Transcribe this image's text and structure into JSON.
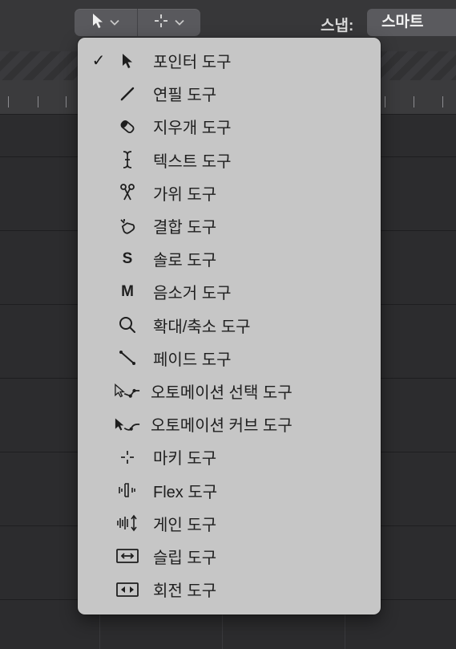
{
  "toolbar": {
    "left_tool_icon": "pointer-icon",
    "right_tool_icon": "marquee-crosshair-icon",
    "snap_label": "스냅:",
    "snap_value": "스마트"
  },
  "menu": {
    "items": [
      {
        "label": "포인터 도구",
        "icon": "pointer-icon",
        "checked": true
      },
      {
        "label": "연필 도구",
        "icon": "pencil-icon",
        "checked": false
      },
      {
        "label": "지우개 도구",
        "icon": "eraser-icon",
        "checked": false
      },
      {
        "label": "텍스트 도구",
        "icon": "text-cursor-icon",
        "checked": false
      },
      {
        "label": "가위 도구",
        "icon": "scissors-icon",
        "checked": false
      },
      {
        "label": "결합 도구",
        "icon": "glue-icon",
        "checked": false
      },
      {
        "label": "솔로 도구",
        "icon": "solo-letter-icon",
        "icon_text": "S",
        "checked": false
      },
      {
        "label": "음소거 도구",
        "icon": "mute-letter-icon",
        "icon_text": "M",
        "checked": false
      },
      {
        "label": "확대/축소 도구",
        "icon": "magnifier-icon",
        "checked": false
      },
      {
        "label": "페이드 도구",
        "icon": "fade-line-icon",
        "checked": false
      },
      {
        "label": "오토메이션 선택 도구",
        "icon": "automation-select-icon",
        "checked": false
      },
      {
        "label": "오토메이션 커브 도구",
        "icon": "automation-curve-icon",
        "checked": false
      },
      {
        "label": "마키 도구",
        "icon": "marquee-crosshair-icon",
        "checked": false
      },
      {
        "label": "Flex 도구",
        "icon": "flex-icon",
        "checked": false
      },
      {
        "label": "게인 도구",
        "icon": "gain-icon",
        "checked": false
      },
      {
        "label": "슬립 도구",
        "icon": "slip-icon",
        "checked": false
      },
      {
        "label": "회전 도구",
        "icon": "rotate-icon",
        "checked": false
      }
    ],
    "check_glyph": "✓"
  }
}
